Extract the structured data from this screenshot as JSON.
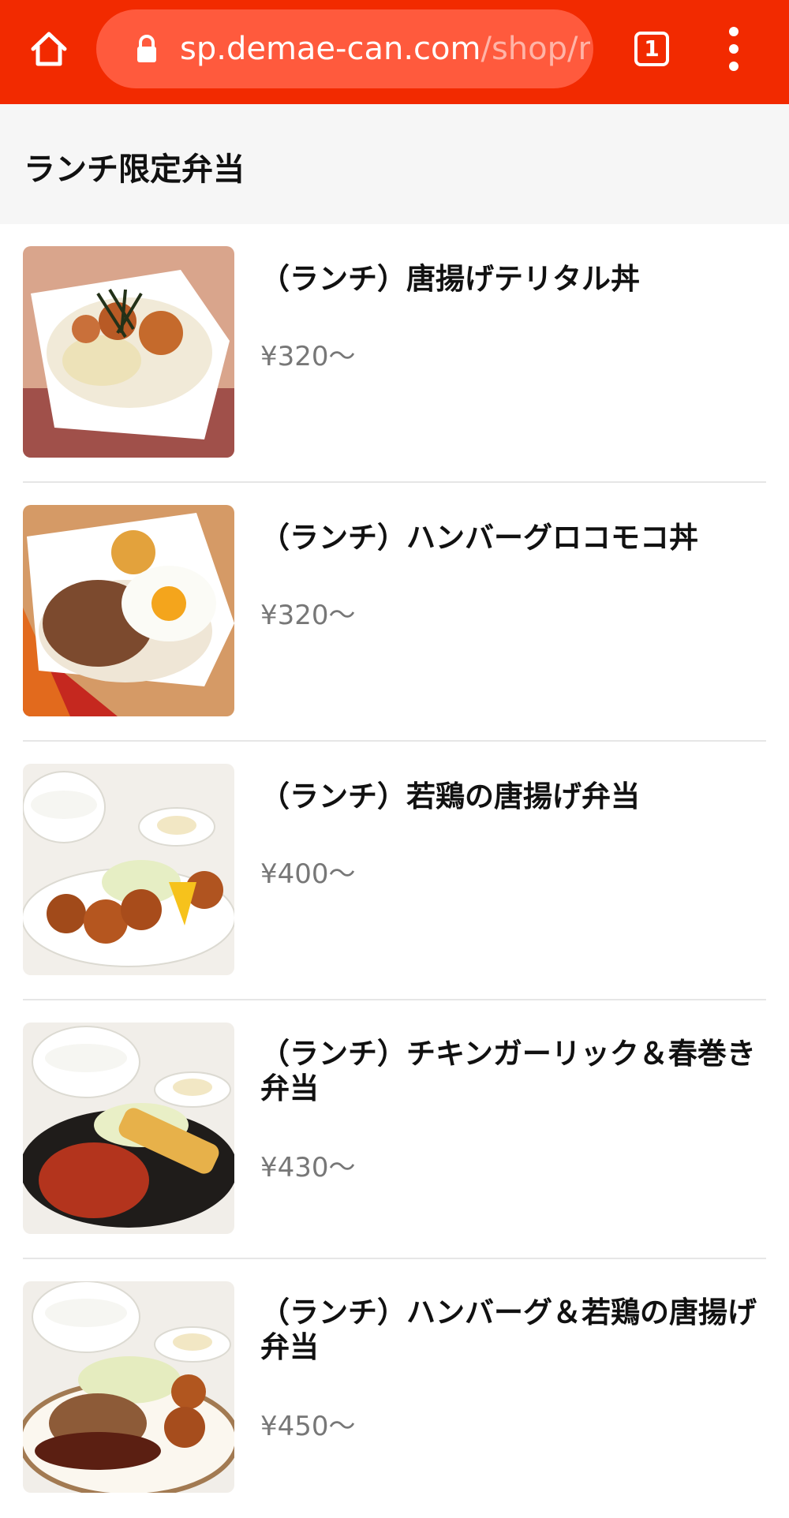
{
  "browser": {
    "url_domain": "sp.demae-can.com",
    "url_path": "/shop/m",
    "tab_count": "1",
    "accent_color": "#f22a00"
  },
  "section": {
    "title": "ランチ限定弁当"
  },
  "items": [
    {
      "name": "（ランチ）唐揚げテリタル丼",
      "price": "¥320～"
    },
    {
      "name": "（ランチ）ハンバーグロコモコ丼",
      "price": "¥320～"
    },
    {
      "name": "（ランチ）若鶏の唐揚げ弁当",
      "price": "¥400～"
    },
    {
      "name": "（ランチ）チキンガーリック＆春巻き弁当",
      "price": "¥430～"
    },
    {
      "name": "（ランチ）ハンバーグ＆若鶏の唐揚げ弁当",
      "price": "¥450～"
    }
  ]
}
